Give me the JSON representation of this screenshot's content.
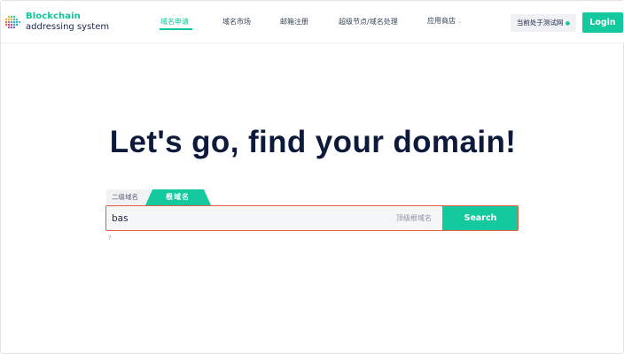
{
  "logo": {
    "line1": "Blockchain",
    "line2": "addressing system"
  },
  "nav": {
    "items": [
      {
        "label": "域名申请",
        "active": true
      },
      {
        "label": "域名市场",
        "active": false
      },
      {
        "label": "邮箱注册",
        "active": false
      },
      {
        "label": "超级节点/域名处理",
        "active": false
      },
      {
        "label": "应用商店",
        "active": false,
        "has_dropdown": true
      }
    ]
  },
  "network_badge": {
    "label": "当前处于测试网",
    "indicator": "●"
  },
  "login_label": "Login",
  "hero": {
    "title": "Let's go, find your domain!"
  },
  "tabs": [
    {
      "label": "二级域名",
      "active": false
    },
    {
      "label": "根域名",
      "active": true
    }
  ],
  "search": {
    "value": "bas",
    "suffix_label": "顶级根域名",
    "button_label": "Search"
  },
  "help_label": "?",
  "colors": {
    "accent": "#14c99d",
    "error_border": "#e65a3f",
    "title": "#0e1a3b"
  }
}
